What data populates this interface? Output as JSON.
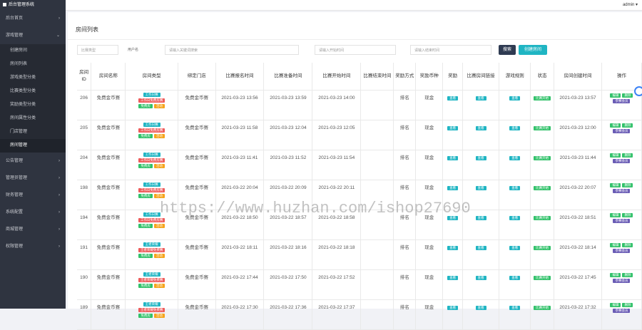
{
  "topbar": {
    "brand": "后台管理系统",
    "user": "admin ▾"
  },
  "sidebar": {
    "items_top": [
      {
        "label": "后台首页",
        "arrow": "›"
      },
      {
        "label": "游戏管理",
        "arrow": "⌄"
      }
    ],
    "sub_items": [
      {
        "label": "创建房间",
        "active": false
      },
      {
        "label": "房间列表",
        "active": false
      },
      {
        "label": "游戏类型分类",
        "active": false
      },
      {
        "label": "比赛类型分类",
        "active": false
      },
      {
        "label": "奖励类型分类",
        "active": false
      },
      {
        "label": "房间属性分类",
        "active": false
      },
      {
        "label": "门店管理",
        "active": false
      },
      {
        "label": "房间管理",
        "active": true
      }
    ],
    "items_bottom": [
      {
        "label": "公告管理",
        "arrow": "›"
      },
      {
        "label": "管理员管理",
        "arrow": "›"
      },
      {
        "label": "财务管理",
        "arrow": "›"
      },
      {
        "label": "系统配置",
        "arrow": "›"
      },
      {
        "label": "商城管理",
        "arrow": "›"
      },
      {
        "label": "权限管理",
        "arrow": "›"
      }
    ]
  },
  "page": {
    "title": "房间列表"
  },
  "filters": {
    "type_placeholder": "比赛类型",
    "username_label": "用户名",
    "keyword_placeholder": "请输入关键词搜索",
    "start_placeholder": "请输入开始时间",
    "end_placeholder": "请输入结束时间",
    "search_button": "搜索",
    "create_button": "创建房间"
  },
  "table": {
    "headers": [
      "房间ID",
      "房间名称",
      "房间类型",
      "绑定门店",
      "比赛报名时间",
      "比赛准备时间",
      "比赛开始时间",
      "比赛结束时间",
      "奖励方式",
      "奖励币种",
      "奖励",
      "比赛房间链接",
      "游戏规则",
      "状态",
      "房间创建时间",
      "操作"
    ],
    "rows": [
      {
        "id": "206",
        "name": "免费金币赛",
        "badges": [
          "工作日赛",
          "工作日免费房赛",
          "免费房",
          "活动"
        ],
        "store": "免费金币赛",
        "signup": "2021-03-23 13:56",
        "prepare": "2021-03-23 13:59",
        "start": "2021-03-23 14:00",
        "end": "",
        "method": "排名",
        "currency": "现金",
        "reward": "查看",
        "link": "查看",
        "rule": "查看",
        "status": "比赛开始",
        "created": "2021-03-23 13:57",
        "ops": [
          "编辑",
          "删除",
          "参赛会员"
        ]
      },
      {
        "id": "205",
        "name": "免费金币赛",
        "badges": [
          "工作日赛",
          "工作日免费房赛",
          "免费房",
          "活动"
        ],
        "store": "免费金币赛",
        "signup": "2021-03-23 11:58",
        "prepare": "2021-03-23 12:04",
        "start": "2021-03-23 12:05",
        "end": "",
        "method": "排名",
        "currency": "现金",
        "reward": "查看",
        "link": "查看",
        "rule": "查看",
        "status": "比赛开始",
        "created": "2021-03-23 12:00",
        "ops": [
          "编辑",
          "删除",
          "参赛会员"
        ]
      },
      {
        "id": "204",
        "name": "免费金币赛",
        "badges": [
          "工作日赛",
          "工作日免费房赛",
          "免费房",
          "活动"
        ],
        "store": "免费金币赛",
        "signup": "2021-03-23 11:41",
        "prepare": "2021-03-23 11:52",
        "start": "2021-03-23 11:54",
        "end": "",
        "method": "排名",
        "currency": "现金",
        "reward": "查看",
        "link": "查看",
        "rule": "查看",
        "status": "比赛开始",
        "created": "2021-03-23 11:44",
        "ops": [
          "编辑",
          "删除",
          "参赛会员"
        ]
      },
      {
        "id": "198",
        "name": "免费金币赛",
        "badges": [
          "工作日赛",
          "工作日免费房赛",
          "免费房",
          "活动"
        ],
        "store": "免费金币赛",
        "signup": "2021-03-22 20:04",
        "prepare": "2021-03-22 20:09",
        "start": "2021-03-22 20:11",
        "end": "",
        "method": "排名",
        "currency": "现金",
        "reward": "查看",
        "link": "查看",
        "rule": "查看",
        "status": "比赛开始",
        "created": "2021-03-22 20:07",
        "ops": [
          "编辑",
          "删除",
          "参赛会员"
        ]
      },
      {
        "id": "194",
        "name": "免费金币赛",
        "badges": [
          "工作日赛",
          "工作日免费房赛",
          "免费房",
          "活动"
        ],
        "store": "免费金币赛",
        "signup": "2021-03-22 18:50",
        "prepare": "2021-03-22 18:57",
        "start": "2021-03-22 18:58",
        "end": "",
        "method": "排名",
        "currency": "现金",
        "reward": "查看",
        "link": "查看",
        "rule": "查看",
        "status": "比赛开始",
        "created": "2021-03-22 18:51",
        "ops": [
          "编辑",
          "删除",
          "参赛会员"
        ]
      },
      {
        "id": "191",
        "name": "免费金币赛",
        "badges": [
          "王者荣耀",
          "王者荣耀免费赛",
          "免费房",
          "活动"
        ],
        "store": "免费金币赛",
        "signup": "2021-03-22 18:11",
        "prepare": "2021-03-22 18:16",
        "start": "2021-03-22 18:18",
        "end": "",
        "method": "排名",
        "currency": "现金",
        "reward": "查看",
        "link": "查看",
        "rule": "查看",
        "status": "比赛开始",
        "created": "2021-03-22 18:14",
        "ops": [
          "编辑",
          "删除",
          "参赛会员"
        ]
      },
      {
        "id": "190",
        "name": "免费金币赛",
        "badges": [
          "王者荣耀",
          "王者荣耀免费赛",
          "免费房",
          "活动"
        ],
        "store": "免费金币赛",
        "signup": "2021-03-22 17:44",
        "prepare": "2021-03-22 17:50",
        "start": "2021-03-22 17:52",
        "end": "",
        "method": "排名",
        "currency": "现金",
        "reward": "查看",
        "link": "查看",
        "rule": "查看",
        "status": "比赛开始",
        "created": "2021-03-22 17:45",
        "ops": [
          "编辑",
          "删除",
          "参赛会员"
        ]
      },
      {
        "id": "189",
        "name": "免费金币赛",
        "badges": [
          "王者荣耀",
          "王者荣耀免费赛",
          "免费房",
          "活动"
        ],
        "store": "免费金币赛",
        "signup": "2021-03-22 17:30",
        "prepare": "2021-03-22 17:36",
        "start": "2021-03-22 17:37",
        "end": "",
        "method": "排名",
        "currency": "现金",
        "reward": "查看",
        "link": "查看",
        "rule": "查看",
        "status": "比赛开始",
        "created": "2021-03-22 17:32",
        "ops": [
          "编辑",
          "删除",
          "参赛会员"
        ]
      }
    ]
  },
  "watermark": "https://www.huzhan.com/ishop27690",
  "colors": {
    "sidebar": "#2f3440",
    "teal": "#1fb5c3",
    "red": "#ee5b5b",
    "green": "#33c26b",
    "orange": "#f5a51e",
    "purple": "#6a5cb5",
    "search": "#2f3b52"
  }
}
